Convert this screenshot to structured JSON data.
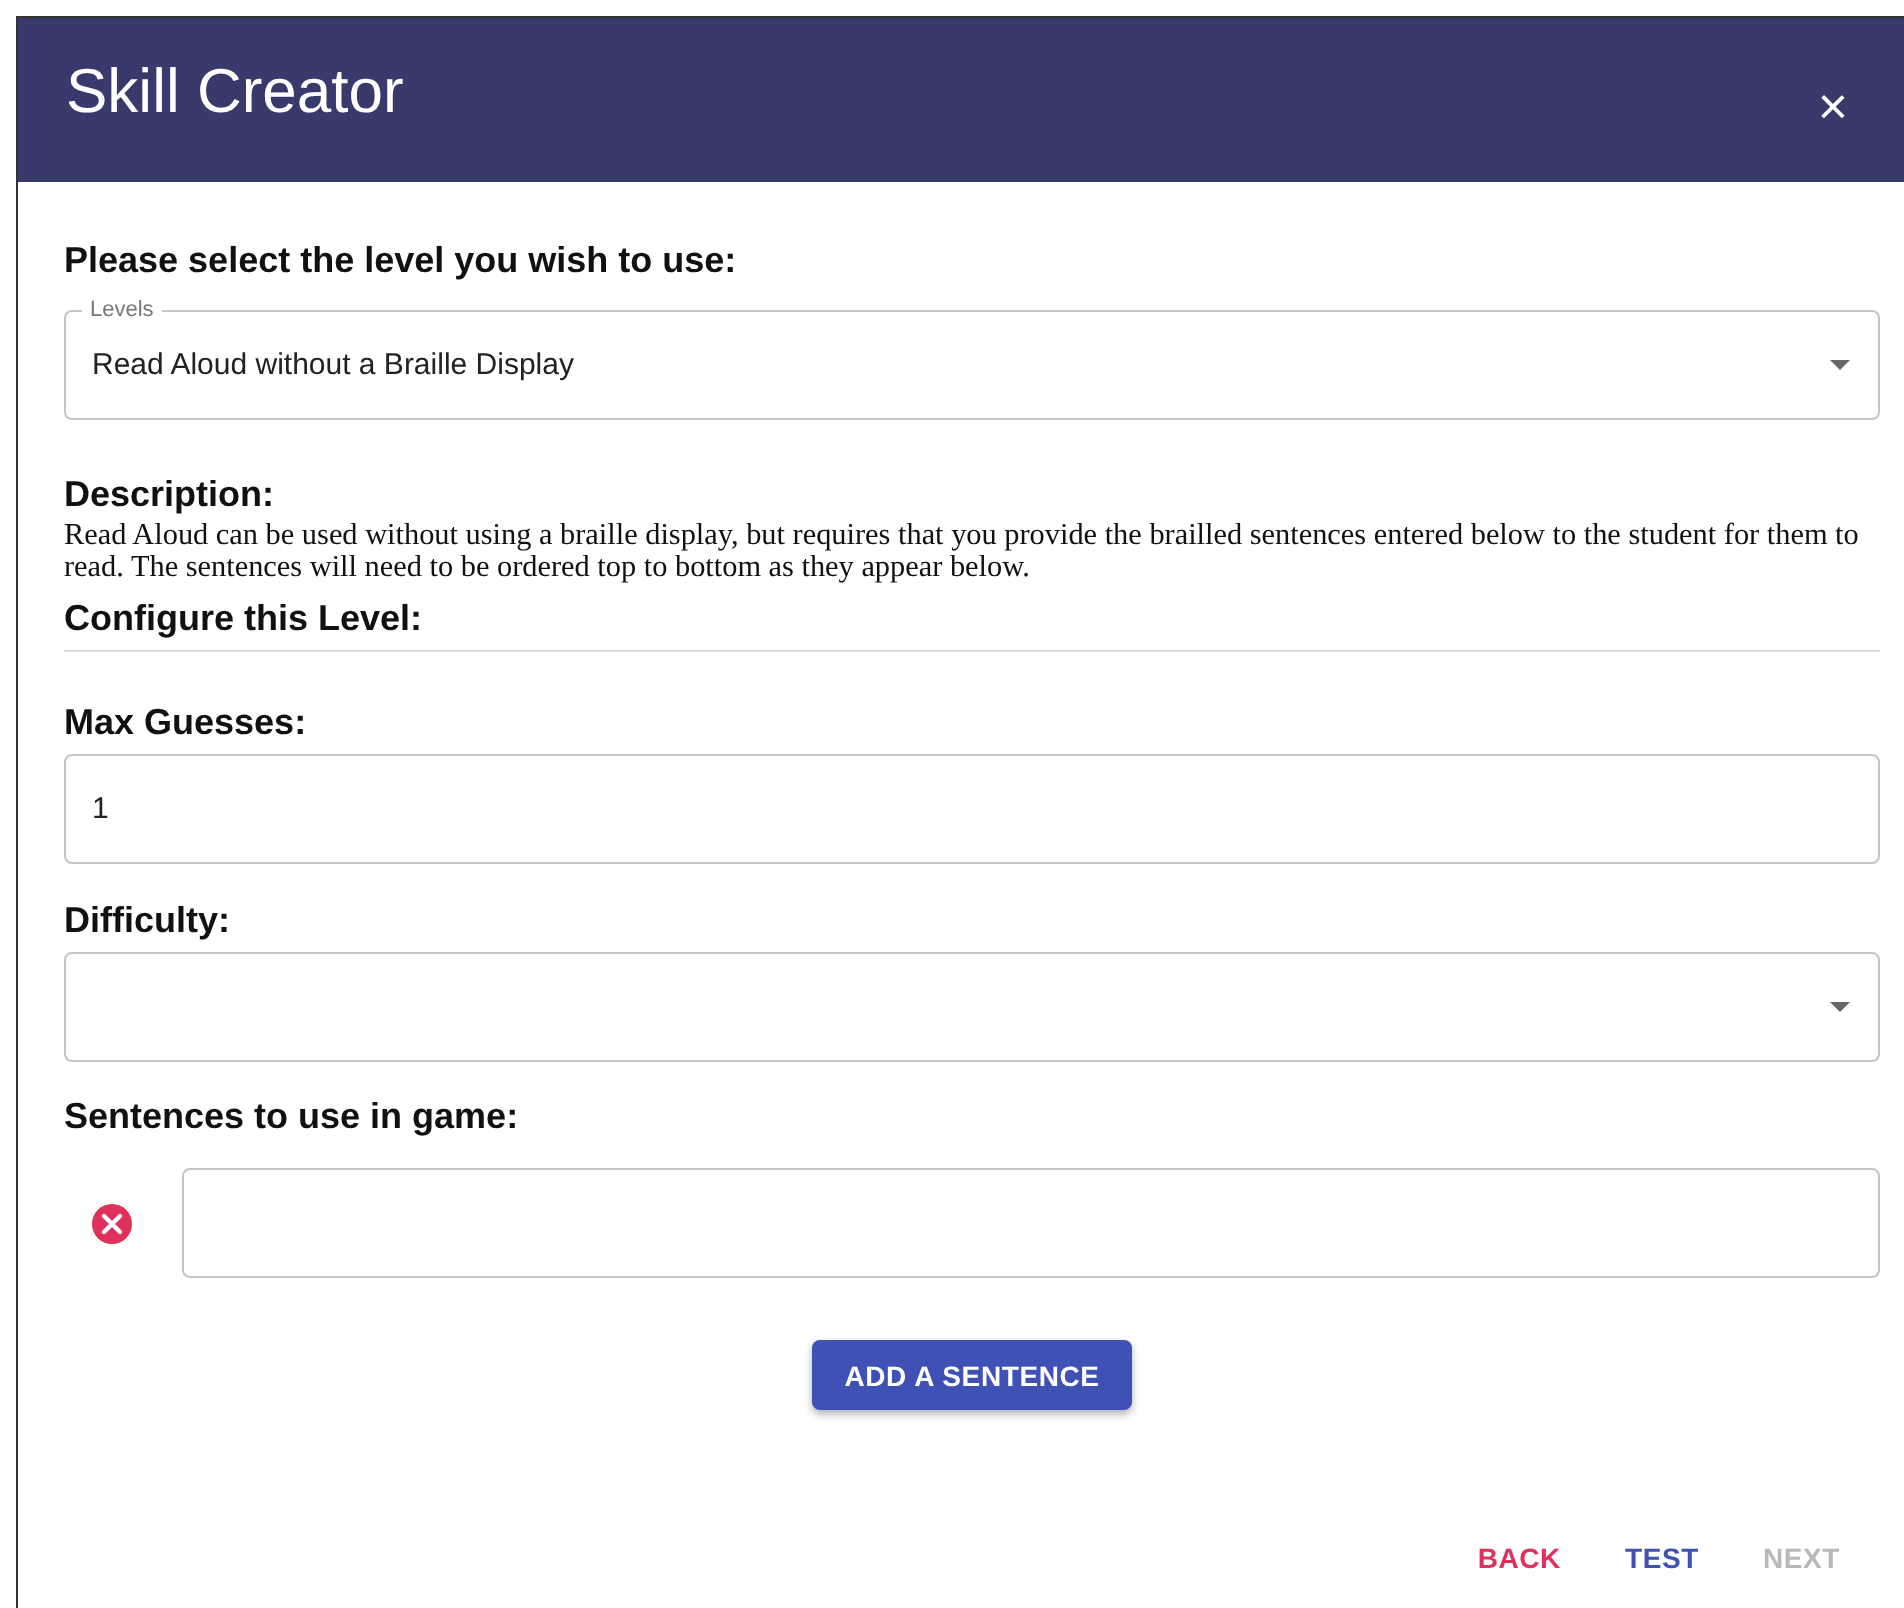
{
  "window": {
    "title": "Skill Creator",
    "close": "×"
  },
  "level_section": {
    "heading": "Please select the level you wish to use:",
    "select": {
      "label": "Levels",
      "value": "Read Aloud without a Braille Display"
    }
  },
  "description": {
    "heading": "Description:",
    "text": "Read Aloud can be used without using a braille display, but requires that you provide the brailled sentences entered below to the student for them to read. The sentences will need to be ordered top to bottom as they appear below."
  },
  "configure": {
    "heading": "Configure this Level:"
  },
  "max_guesses": {
    "label": "Max Guesses:",
    "value": "1"
  },
  "difficulty": {
    "label": "Difficulty:"
  },
  "sentences": {
    "label": "Sentences to use in game:",
    "rows": [
      {
        "removable": true
      }
    ]
  },
  "add_button": {
    "label": "ADD A SENTENCE"
  },
  "footer": [
    {
      "label": "BACK",
      "kind": "secondary",
      "disabled": false
    },
    {
      "label": "TEST",
      "kind": "primary",
      "disabled": false
    },
    {
      "label": "NEXT",
      "disabled": true
    }
  ]
}
